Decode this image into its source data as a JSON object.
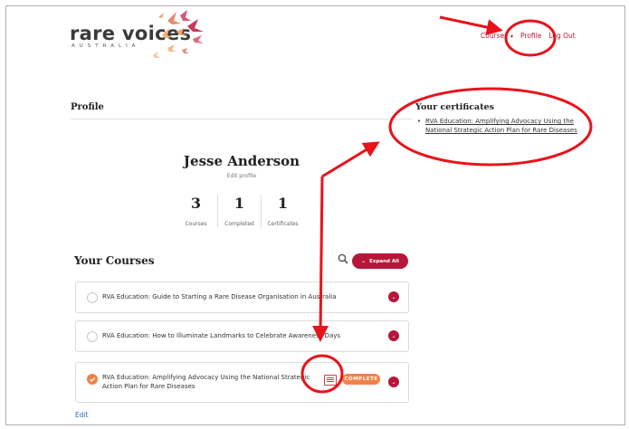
{
  "header": {
    "logo_word": "rare voices",
    "logo_sub": "AUSTRALIA",
    "nav": {
      "courses": "Courses",
      "profile": "Profile",
      "logout": "Log Out"
    }
  },
  "profile": {
    "heading": "Profile",
    "name": "Jesse Anderson",
    "edit_profile": "Edit profile",
    "stats": [
      {
        "value": "3",
        "label": "Courses"
      },
      {
        "value": "1",
        "label": "Completed"
      },
      {
        "value": "1",
        "label": "Certificates"
      }
    ]
  },
  "certificates": {
    "heading": "Your certificates",
    "items": [
      "RVA Education: Amplifying Advocacy Using the National Strategic Action Plan for Rare Diseases"
    ]
  },
  "courses": {
    "heading": "Your Courses",
    "expand_all": "Expand All",
    "items": [
      {
        "title": "RVA Education: Guide to Starting a Rare Disease Organisation in Australia",
        "complete": false
      },
      {
        "title": "RVA Education: How to Illuminate Landmarks to Celebrate Awareness Days",
        "complete": false
      },
      {
        "title": "RVA Education: Amplifying Advocacy Using the National Strategic Action Plan for Rare Diseases",
        "complete": true,
        "status": "COMPLETE"
      }
    ],
    "edit": "Edit"
  },
  "colors": {
    "brand": "#b5173a",
    "accent": "#f08248",
    "annotation": "#e8131b",
    "link": "#2a6fb6"
  }
}
